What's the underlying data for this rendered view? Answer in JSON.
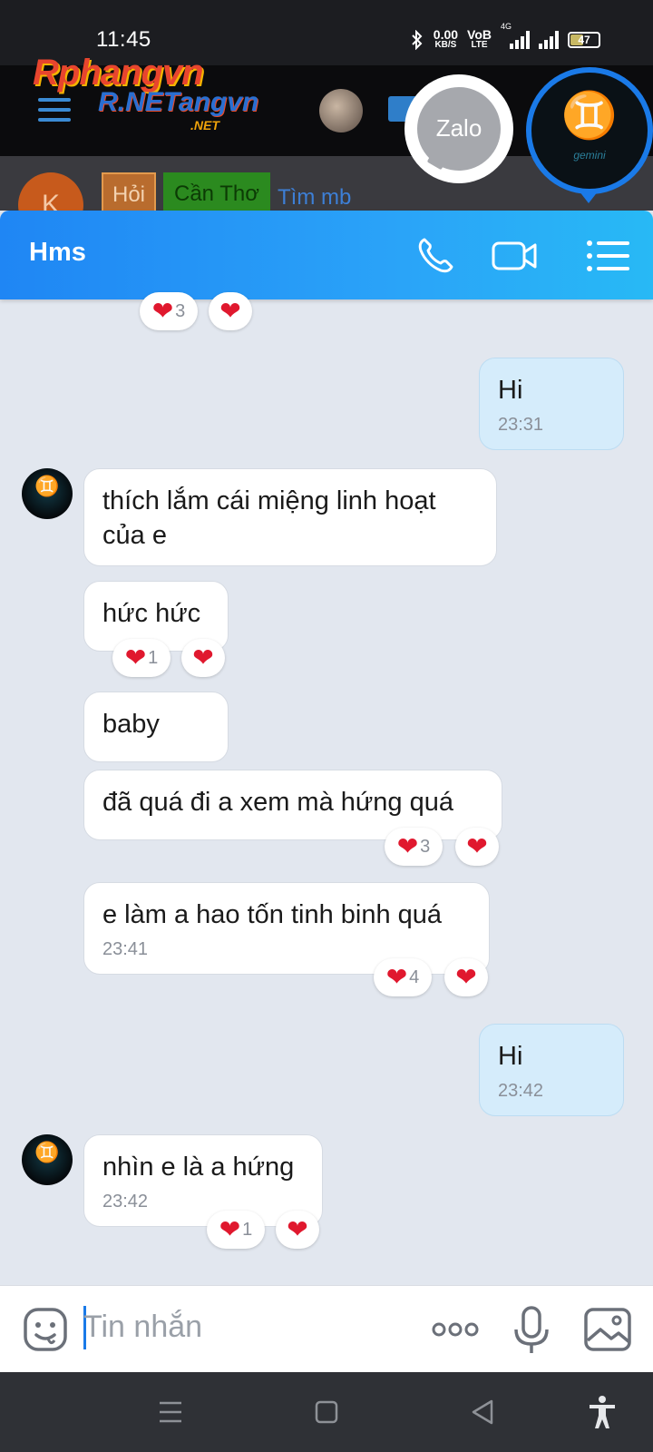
{
  "status_bar": {
    "time": "11:45",
    "net_speed_value": "0.00",
    "net_speed_unit": "KB/S",
    "volte_top": "VoB",
    "volte_bottom": "LTE",
    "network": "4G",
    "battery": "47"
  },
  "background_page": {
    "logo_main": "Rphangvn",
    "logo_secondary": "R.NETangvn",
    "logo_domain": ".NET",
    "avatar_letter": "K",
    "tag_hoi": "Hỏi",
    "tag_city": "Cần Thơ",
    "tag_search": "Tìm mb"
  },
  "floating": {
    "zalo_label": "Zalo",
    "gem_symbol": "♊",
    "gem_word": "gemini"
  },
  "chat": {
    "contact_name": "Hms",
    "icons": {
      "call": "phone-icon",
      "video": "video-call-icon",
      "menu": "list-menu-icon"
    },
    "contact_avatar_symbol": "♊",
    "messages": [
      {
        "sender": "contact",
        "text": "",
        "time": "",
        "reactions": {
          "count": "3"
        }
      },
      {
        "sender": "me",
        "text": "Hi",
        "time": "23:31"
      },
      {
        "sender": "contact",
        "text": "thích lắm cái miệng linh hoạt của e",
        "time": ""
      },
      {
        "sender": "contact",
        "text": "hức hức",
        "time": "",
        "reactions": {
          "count": "1"
        }
      },
      {
        "sender": "contact",
        "text": "baby",
        "time": ""
      },
      {
        "sender": "contact",
        "text": "đã quá đi a xem mà hứng quá",
        "time": "",
        "reactions": {
          "count": "3"
        }
      },
      {
        "sender": "contact",
        "text": "e làm a hao tốn tinh binh quá",
        "time": "23:41",
        "reactions": {
          "count": "4"
        }
      },
      {
        "sender": "me",
        "text": "Hi",
        "time": "23:42"
      },
      {
        "sender": "contact",
        "text": "nhìn e là a hứng",
        "time": "23:42",
        "reactions": {
          "count": "1"
        }
      }
    ],
    "heart_glyph": "❤",
    "input": {
      "placeholder": "Tin nhắn",
      "icons": [
        "emoji-icon",
        "more-icon",
        "microphone-icon",
        "image-icon"
      ]
    }
  },
  "nav_bar": {
    "icons": [
      "menu-icon",
      "home-square-icon",
      "back-triangle-icon",
      "accessibility-icon"
    ]
  },
  "colors": {
    "header_gradient_start": "#1f86f4",
    "header_gradient_end": "#28b9f5",
    "chat_background": "#e2e7ef",
    "outgoing_bubble": "#d5ecfb",
    "heart_red": "#e0182e"
  }
}
